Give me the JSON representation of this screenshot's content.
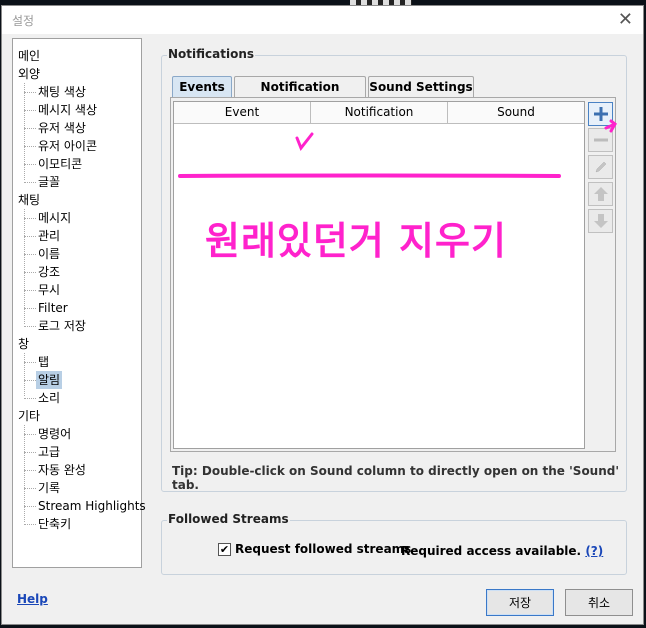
{
  "window": {
    "title": "설정",
    "close_glyph": "✕"
  },
  "tree": {
    "root_main": "메인",
    "root_appearance": "외양",
    "appearance": [
      "채팅 색상",
      "메시지 색상",
      "유저 색상",
      "유저 아이콘",
      "이모티콘",
      "글꼴"
    ],
    "root_chat": "채팅",
    "chat": [
      "메시지",
      "관리",
      "이름",
      "강조",
      "무시",
      "Filter",
      "로그 저장"
    ],
    "root_window": "창",
    "window_children": [
      "탭",
      "알림",
      "소리"
    ],
    "root_other": "기타",
    "other": [
      "명령어",
      "고급",
      "자동 완성",
      "기록",
      "Stream Highlights",
      "단축키"
    ],
    "selected": "알림"
  },
  "notifications": {
    "group_title": "Notifications",
    "tabs": [
      "Events",
      "Notification Settings",
      "Sound Settings"
    ],
    "active_tab": "Events",
    "columns": [
      "Event",
      "Notification",
      "Sound"
    ],
    "tip": "Tip: Double-click on Sound column to directly open on the 'Sound' tab."
  },
  "side_buttons": [
    "plus-icon",
    "minus-icon",
    "pencil-icon",
    "arrow-up-icon",
    "arrow-down-icon"
  ],
  "annotation": {
    "text": "원래있던거 지우기",
    "color": "#ff22cc"
  },
  "followed": {
    "group_title": "Followed Streams",
    "checkbox_label": "Request followed streams",
    "checked": true,
    "access_text": "Required access available.",
    "access_link": "(?)"
  },
  "footer": {
    "help": "Help",
    "save": "저장",
    "cancel": "취소"
  }
}
